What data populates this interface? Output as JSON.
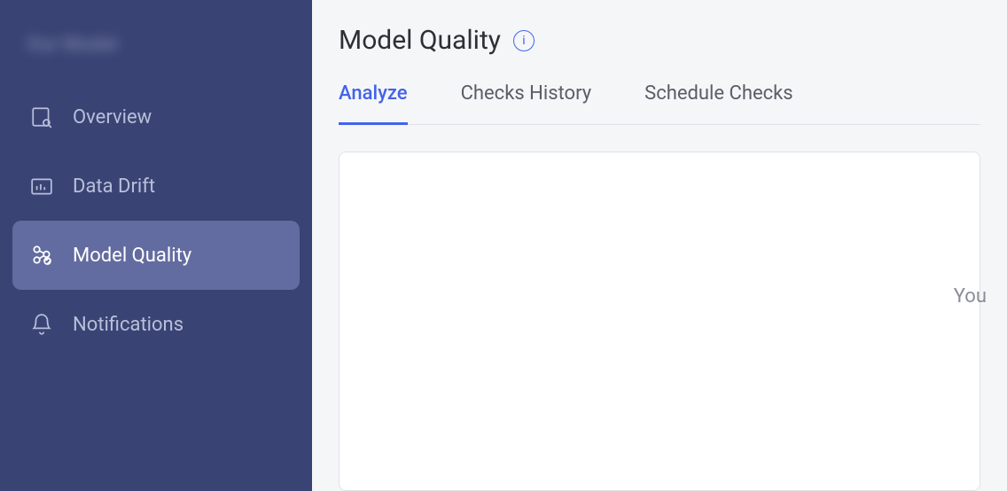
{
  "sidebar": {
    "header": "Our Model",
    "items": [
      {
        "label": "Overview",
        "icon": "overview-icon",
        "active": false
      },
      {
        "label": "Data Drift",
        "icon": "data-drift-icon",
        "active": false
      },
      {
        "label": "Model Quality",
        "icon": "model-quality-icon",
        "active": true
      },
      {
        "label": "Notifications",
        "icon": "bell-icon",
        "active": false
      }
    ]
  },
  "main": {
    "title": "Model Quality",
    "info_label": "i",
    "tabs": [
      {
        "label": "Analyze",
        "active": true
      },
      {
        "label": "Checks History",
        "active": false
      },
      {
        "label": "Schedule Checks",
        "active": false
      }
    ],
    "panel_text": "You"
  }
}
